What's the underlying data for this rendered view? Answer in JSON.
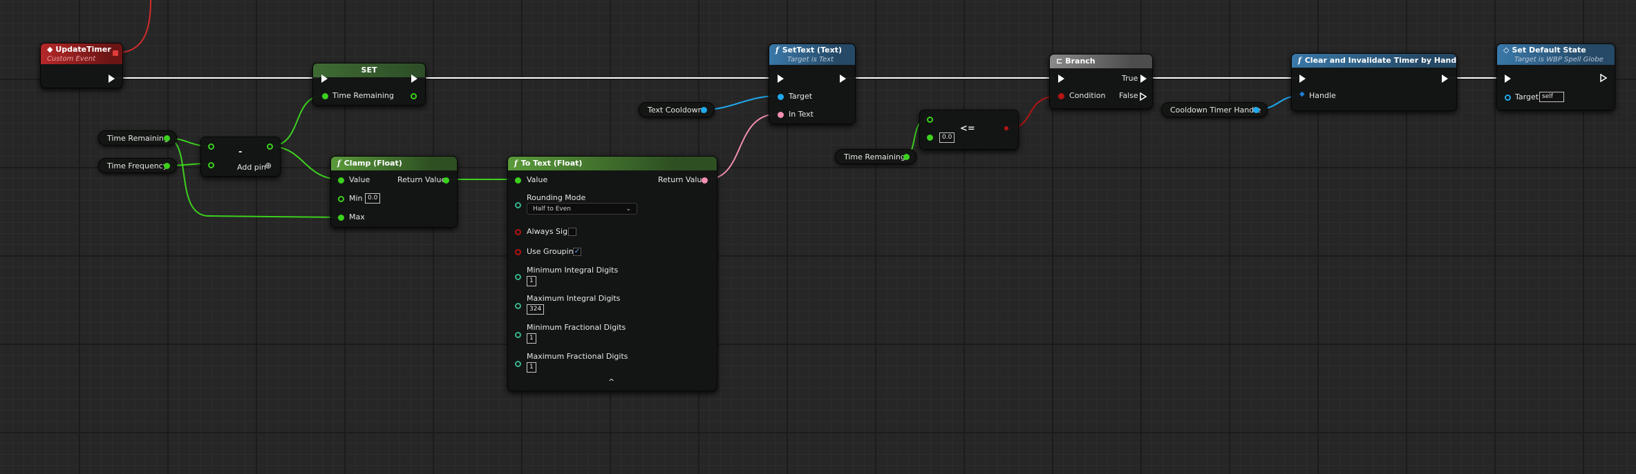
{
  "nodes": {
    "update_timer": {
      "title": "UpdateTimer",
      "subtitle": "Custom Event"
    },
    "set": {
      "title": "SET",
      "pin": "Time Remaining"
    },
    "minus": {
      "op": "-",
      "add_pin": "Add pin"
    },
    "clamp": {
      "title": "Clamp (Float)",
      "value": "Value",
      "min": "Min",
      "min_val": "0.0",
      "max": "Max",
      "return": "Return Value"
    },
    "to_text": {
      "title": "To Text (Float)",
      "value": "Value",
      "return": "Return Value",
      "rounding_label": "Rounding Mode",
      "rounding_value": "Half to Even",
      "always_sign": "Always Sign",
      "use_grouping": "Use Grouping",
      "min_int_label": "Minimum Integral Digits",
      "min_int_val": "1",
      "max_int_label": "Maximum Integral Digits",
      "max_int_val": "324",
      "min_frac_label": "Minimum Fractional Digits",
      "min_frac_val": "1",
      "max_frac_label": "Maximum Fractional Digits",
      "max_frac_val": "1",
      "collapse": "^"
    },
    "set_text": {
      "title": "SetText (Text)",
      "subtitle": "Target is Text",
      "target": "Target",
      "in_text": "In Text"
    },
    "compare": {
      "op": "<=",
      "b_val": "0.0"
    },
    "branch": {
      "title": "Branch",
      "condition": "Condition",
      "true": "True",
      "false": "False"
    },
    "clear_timer": {
      "title": "Clear and Invalidate Timer by Handle",
      "handle": "Handle"
    },
    "set_default": {
      "title": "Set Default State",
      "subtitle": "Target is WBP Spell Globe",
      "target": "Target",
      "target_val": "self"
    }
  },
  "vars": {
    "time_remaining_1": "Time Remaining",
    "time_frequency": "Time Frequency",
    "text_cooldown": "Text Cooldown",
    "time_remaining_2": "Time Remaining",
    "cooldown_handle": "Cooldown Timer Handle"
  },
  "colors": {
    "exec": "#ffffff",
    "float": "#3cd11e",
    "object": "#1fa9ee",
    "text": "#f48fb1",
    "bool": "#b31414",
    "event": "#b52828"
  },
  "icons": {
    "event": "diamond-icon",
    "function": "function-icon",
    "branch": "branch-icon",
    "dropdown": "chevron-down-icon",
    "add_pin": "plus-circle-icon",
    "check": "checkmark-icon"
  }
}
